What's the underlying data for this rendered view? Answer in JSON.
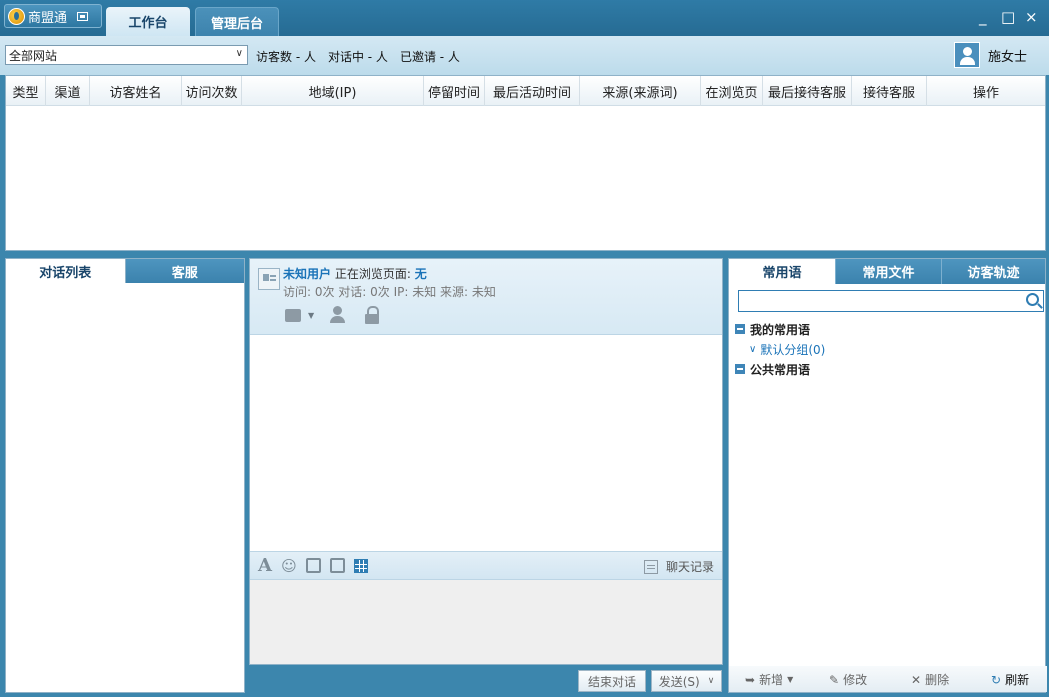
{
  "app": {
    "name": "商盟通"
  },
  "tabs": [
    {
      "label": "工作台"
    },
    {
      "label": "管理后台"
    }
  ],
  "window_controls": {
    "minimize": "_",
    "maximize": "□",
    "close": "×"
  },
  "filter": {
    "site_selected": "全部网站",
    "stats": [
      "访客数 - 人",
      "对话中 - 人",
      "已邀请 - 人"
    ],
    "user_name": "施女士"
  },
  "visitor_table": {
    "columns": [
      "类型",
      "渠道",
      "访客姓名",
      "访问次数",
      "地域(IP)",
      "停留时间",
      "最后活动时间",
      "来源(来源词)",
      "在浏览页",
      "最后接待客服",
      "接待客服",
      "操作"
    ],
    "rows": []
  },
  "left_panel": {
    "tabs": [
      "对话列表",
      "客服"
    ]
  },
  "conversation": {
    "visitor_name": "未知用户",
    "browsing_label": "正在浏览页面:",
    "browsing_page": "无",
    "details": "访问: 0次 对话: 0次 IP: 未知 来源: 未知",
    "history_label": "聊天记录",
    "end_button": "结束对话",
    "send_button": "发送(S)"
  },
  "right_panel": {
    "tabs": [
      "常用语",
      "常用文件",
      "访客轨迹"
    ],
    "search_placeholder": "",
    "tree": {
      "my_phrases": "我的常用语",
      "default_group": "默认分组(0)",
      "public_phrases": "公共常用语"
    },
    "footer": {
      "add": "新增",
      "edit": "修改",
      "delete": "删除",
      "refresh": "刷新"
    }
  }
}
